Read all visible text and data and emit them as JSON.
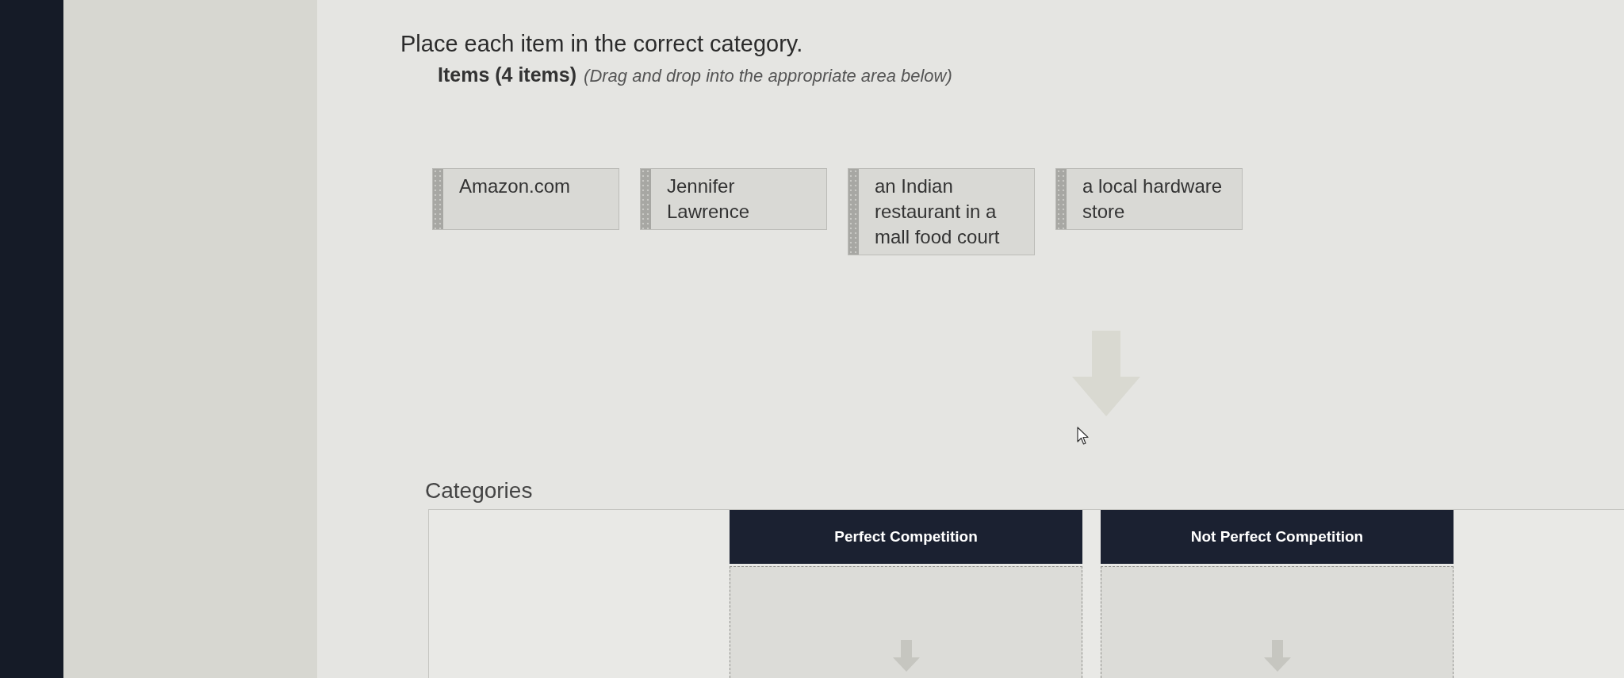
{
  "instruction": "Place each item in the correct category.",
  "items_section": {
    "heading": "Items (4 items)",
    "hint": "(Drag and drop into the appropriate area below)"
  },
  "items": [
    {
      "lines": [
        "Amazon.com"
      ]
    },
    {
      "lines": [
        "Jennifer",
        "Lawrence"
      ]
    },
    {
      "lines": [
        "an Indian",
        "restaurant in a",
        "mall food court"
      ]
    },
    {
      "lines": [
        "a local hardware",
        "store"
      ]
    }
  ],
  "categories_heading": "Categories",
  "categories": [
    {
      "title": "Perfect Competition"
    },
    {
      "title": "Not Perfect Competition"
    }
  ]
}
